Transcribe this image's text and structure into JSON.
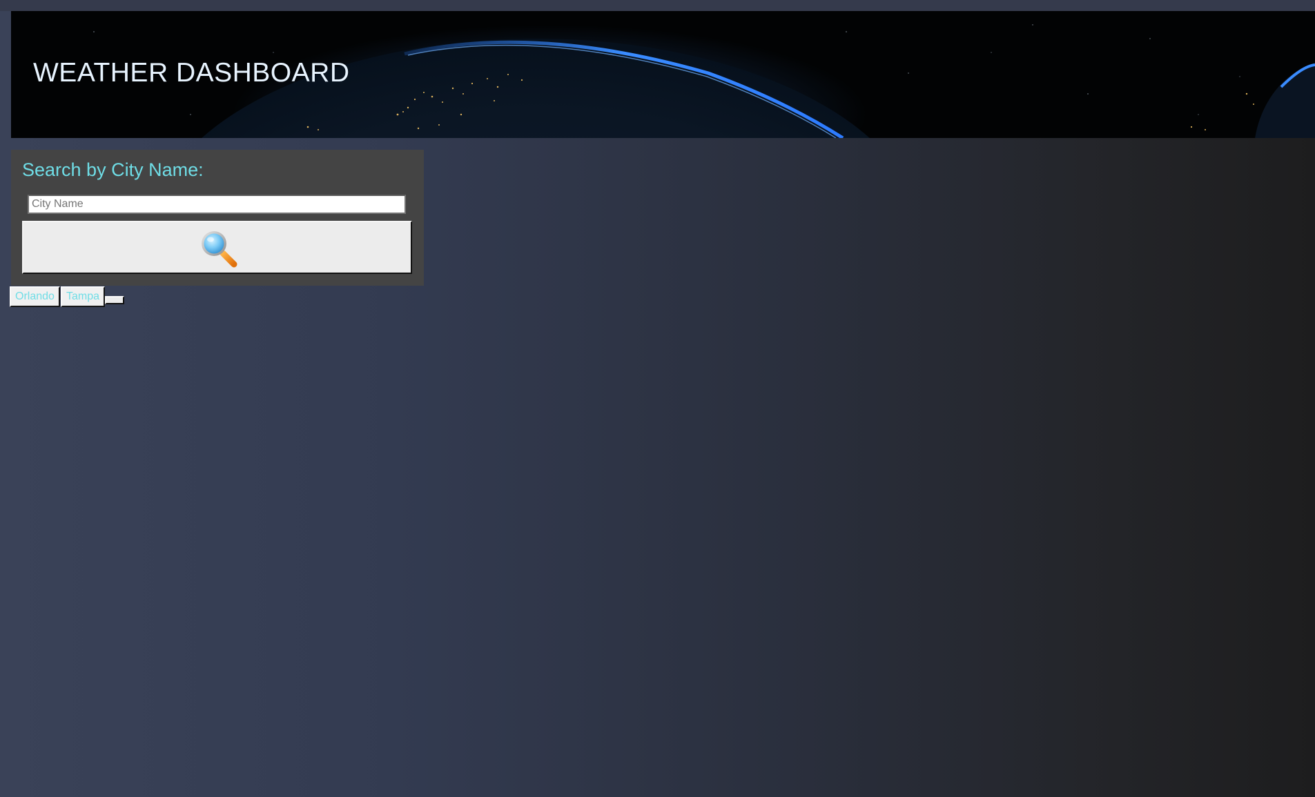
{
  "header": {
    "title": "WEATHER DASHBOARD",
    "background": "earth-from-space-image"
  },
  "search": {
    "heading": "Search by City Name:",
    "input_placeholder": "City Name",
    "input_value": "",
    "button_icon": "magnifying-glass-icon"
  },
  "history": {
    "cities": [
      "Orlando",
      "Tampa"
    ]
  },
  "colors": {
    "accent": "#6fdde6",
    "panel": "#444444",
    "header_title": "#e8f4ff"
  }
}
